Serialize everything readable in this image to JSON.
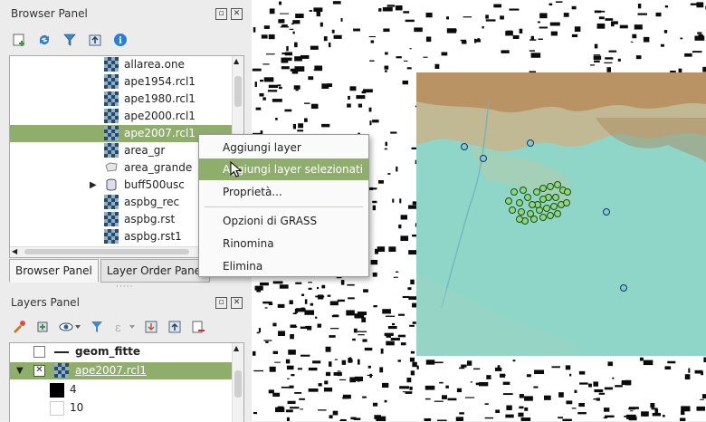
{
  "browser_panel": {
    "title": "Browser Panel",
    "toolbar_icons": [
      "add-layer-icon",
      "refresh-icon",
      "filter-icon",
      "collapse-icon",
      "info-icon"
    ],
    "items": [
      {
        "label": "allarea.one",
        "icon": "raster-icon"
      },
      {
        "label": "ape1954.rcl1",
        "icon": "raster-icon"
      },
      {
        "label": "ape1980.rcl1",
        "icon": "raster-icon"
      },
      {
        "label": "ape2000.rcl1",
        "icon": "raster-icon"
      },
      {
        "label": "ape2007.rcl1",
        "icon": "raster-icon",
        "selected": true
      },
      {
        "label": "area_gr",
        "icon": "raster-icon"
      },
      {
        "label": "area_grande",
        "icon": "polygon-icon"
      },
      {
        "label": "buff500usc",
        "icon": "database-icon",
        "expandable": true
      },
      {
        "label": "aspbg_rec",
        "icon": "raster-icon"
      },
      {
        "label": "aspbg.rst",
        "icon": "raster-icon"
      },
      {
        "label": "aspbg.rst1",
        "icon": "raster-icon"
      }
    ],
    "tabs": [
      "Browser Panel",
      "Layer Order Panel"
    ]
  },
  "layers_panel": {
    "title": "Layers Panel",
    "items": [
      {
        "label": "geom_fitte"
      },
      {
        "label": "ape2007.rcl1",
        "selected": true
      }
    ],
    "legend": [
      {
        "label": "4",
        "color": "#000000"
      },
      {
        "label": "10",
        "color": "#ffffff"
      }
    ]
  },
  "context_menu": {
    "items": [
      {
        "label": "Aggiungi layer"
      },
      {
        "label": "Aggiungi layer selezionati",
        "highlighted": true
      },
      {
        "label": "Proprietà..."
      },
      {
        "label": "Opzioni di GRASS"
      },
      {
        "label": "Rinomina"
      },
      {
        "label": "Elimina"
      }
    ]
  },
  "colors": {
    "selection": "#8fae6c",
    "map_base": "#8fd6c8",
    "points_blue": "#7ec8e8",
    "points_green": "#8fd87a"
  }
}
